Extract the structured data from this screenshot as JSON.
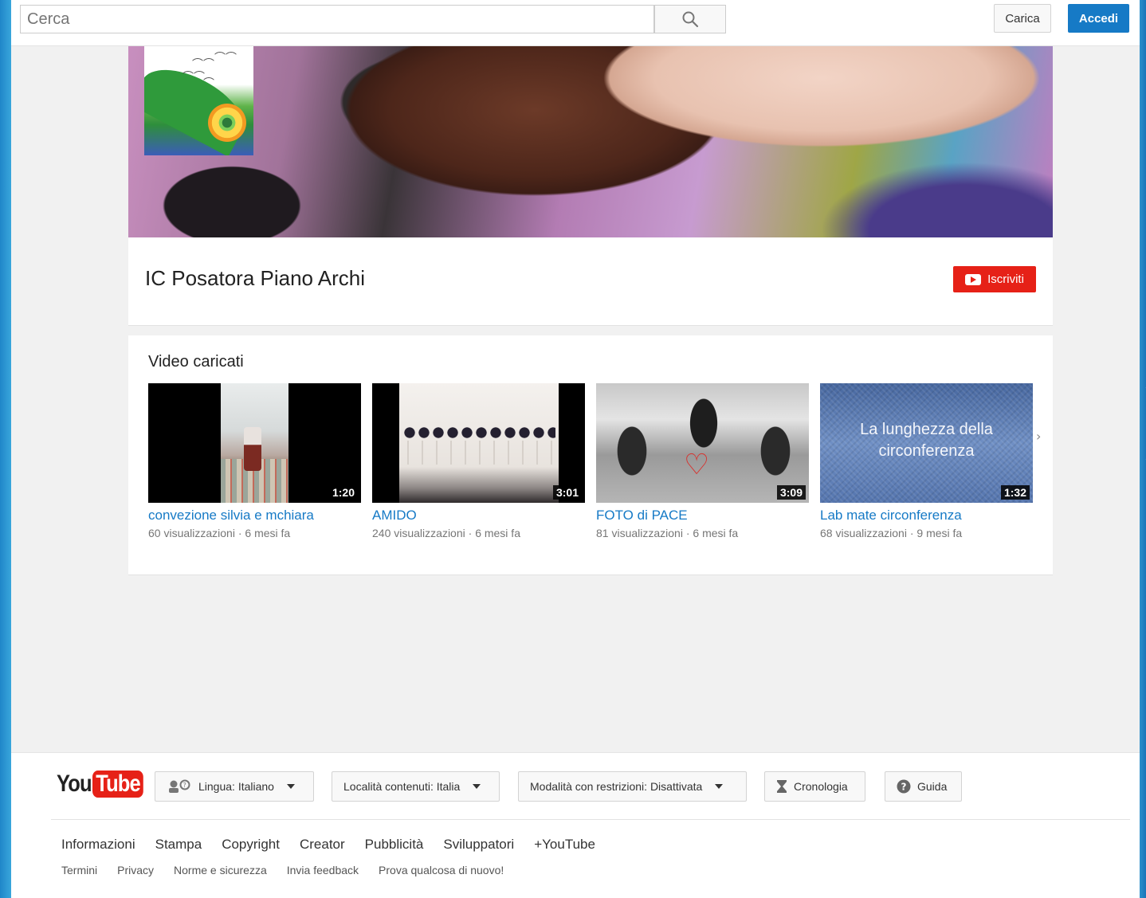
{
  "search": {
    "placeholder": "Cerca"
  },
  "topbar": {
    "upload_label": "Carica",
    "signin_label": "Accedi"
  },
  "channel": {
    "title": "IC Posatora Piano Archi",
    "subscribe_label": "Iscriviti"
  },
  "shelf": {
    "title": "Video caricati",
    "videos": [
      {
        "title": "convezione silvia e mchiara",
        "views": "60 visualizzazioni",
        "age": "6 mesi fa",
        "duration": "1:20"
      },
      {
        "title": "AMIDO",
        "views": "240 visualizzazioni",
        "age": "6 mesi fa",
        "duration": "3:01"
      },
      {
        "title": "FOTO di PACE",
        "views": "81 visualizzazioni",
        "age": "6 mesi fa",
        "duration": "3:09"
      },
      {
        "title": "Lab mate circonferenza",
        "views": "68 visualizzazioni",
        "age": "9 mesi fa",
        "duration": "1:32",
        "thumb_text": "La lunghezza della circonferenza"
      }
    ]
  },
  "footer": {
    "logo_you": "You",
    "logo_tube": "Tube",
    "language": "Lingua: Italiano",
    "location": "Località contenuti: Italia",
    "restricted": "Modalità con restrizioni: Disattivata",
    "history": "Cronologia",
    "help": "Guida",
    "links_primary": [
      "Informazioni",
      "Stampa",
      "Copyright",
      "Creator",
      "Pubblicità",
      "Sviluppatori",
      "+YouTube"
    ],
    "links_secondary": [
      "Termini",
      "Privacy",
      "Norme e sicurezza",
      "Invia feedback",
      "Prova qualcosa di nuovo!"
    ]
  },
  "colors": {
    "accent": "#167ac6",
    "subscribe": "#e62117",
    "background": "#f1f1f1"
  },
  "icons": [
    "search-icon",
    "youtube-play-icon",
    "chevron-right-icon",
    "language-icon",
    "hourglass-icon",
    "help-icon"
  ]
}
